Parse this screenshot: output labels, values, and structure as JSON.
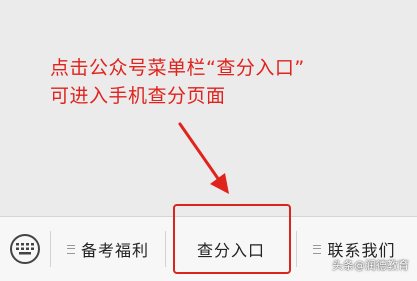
{
  "annotation": {
    "line1": "点击公众号菜单栏“查分入口”",
    "line2": "可进入手机查分页面",
    "color": "#e0231d"
  },
  "menu": {
    "keyboard_icon": "keyboard-icon",
    "items": [
      {
        "label": "备考福利",
        "icon": "menu-list-icon"
      },
      {
        "label": "查分入口",
        "highlighted": true
      },
      {
        "label": "联系我们",
        "icon": "menu-list-icon"
      }
    ]
  },
  "watermark": "头条@润德教育",
  "colors": {
    "highlight": "#d8261f",
    "background": "#ebebeb",
    "menu_background": "#f7f7f7"
  }
}
